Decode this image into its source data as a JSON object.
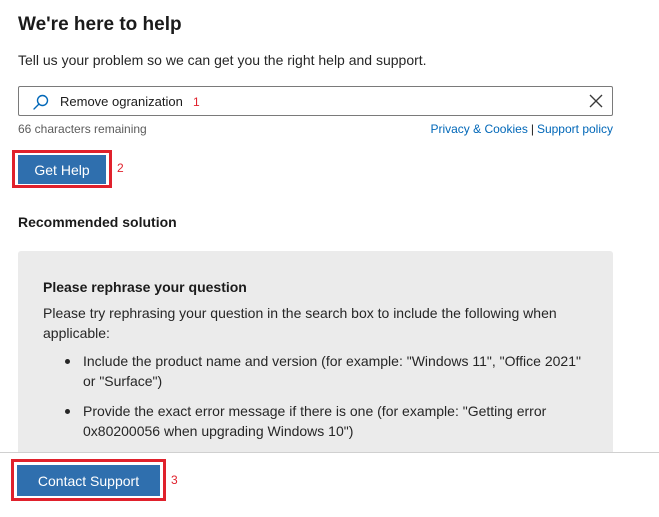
{
  "header": {
    "title": "We're here to help",
    "subtitle": "Tell us your problem so we can get you the right help and support."
  },
  "search": {
    "value": "Remove ogranization",
    "icon": "search-icon",
    "clear_icon": "close-icon",
    "remaining": "66 characters remaining"
  },
  "links": {
    "privacy": "Privacy & Cookies",
    "separator": "|",
    "support_policy": "Support policy"
  },
  "buttons": {
    "get_help": "Get Help",
    "contact_support": "Contact Support"
  },
  "annotations": {
    "one": "1",
    "two": "2",
    "three": "3"
  },
  "recommended": {
    "section_title": "Recommended solution",
    "card_title": "Please rephrase your question",
    "body": "Please try rephrasing your question in the search box to include the following when applicable:",
    "bullets": [
      "Include the product name and version (for example: \"Windows 11\", \"Office 2021\" or \"Surface\")",
      "Provide the exact error message if there is one (for example: \"Getting error 0x80200056 when upgrading Windows 10\")"
    ]
  },
  "colors": {
    "accent": "#2f6fae",
    "link": "#0067b8",
    "highlight": "#e0212c",
    "card_bg": "#ebebeb"
  }
}
